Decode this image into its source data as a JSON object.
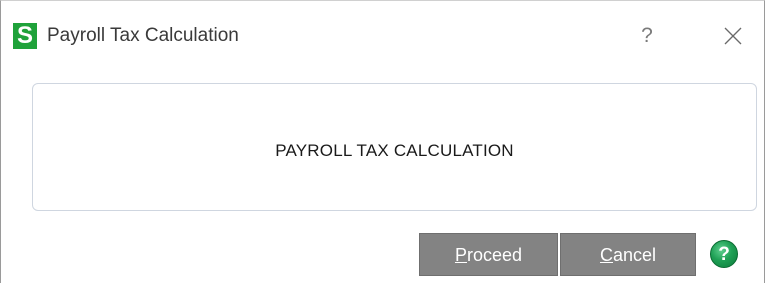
{
  "window": {
    "app_icon_letter": "S",
    "title": "Payroll Tax Calculation",
    "help_glyph": "?",
    "close_icon": "close-icon"
  },
  "panel": {
    "text": "PAYROLL TAX CALCULATION"
  },
  "buttons": {
    "proceed": {
      "hotkey": "P",
      "rest": "roceed"
    },
    "cancel": {
      "hotkey": "C",
      "rest": "ancel"
    },
    "help": {
      "glyph": "?",
      "icon": "help-icon"
    }
  },
  "colors": {
    "app_icon": "#1fa23a",
    "button_bg": "#838383",
    "help_icon": "#1fa055"
  }
}
